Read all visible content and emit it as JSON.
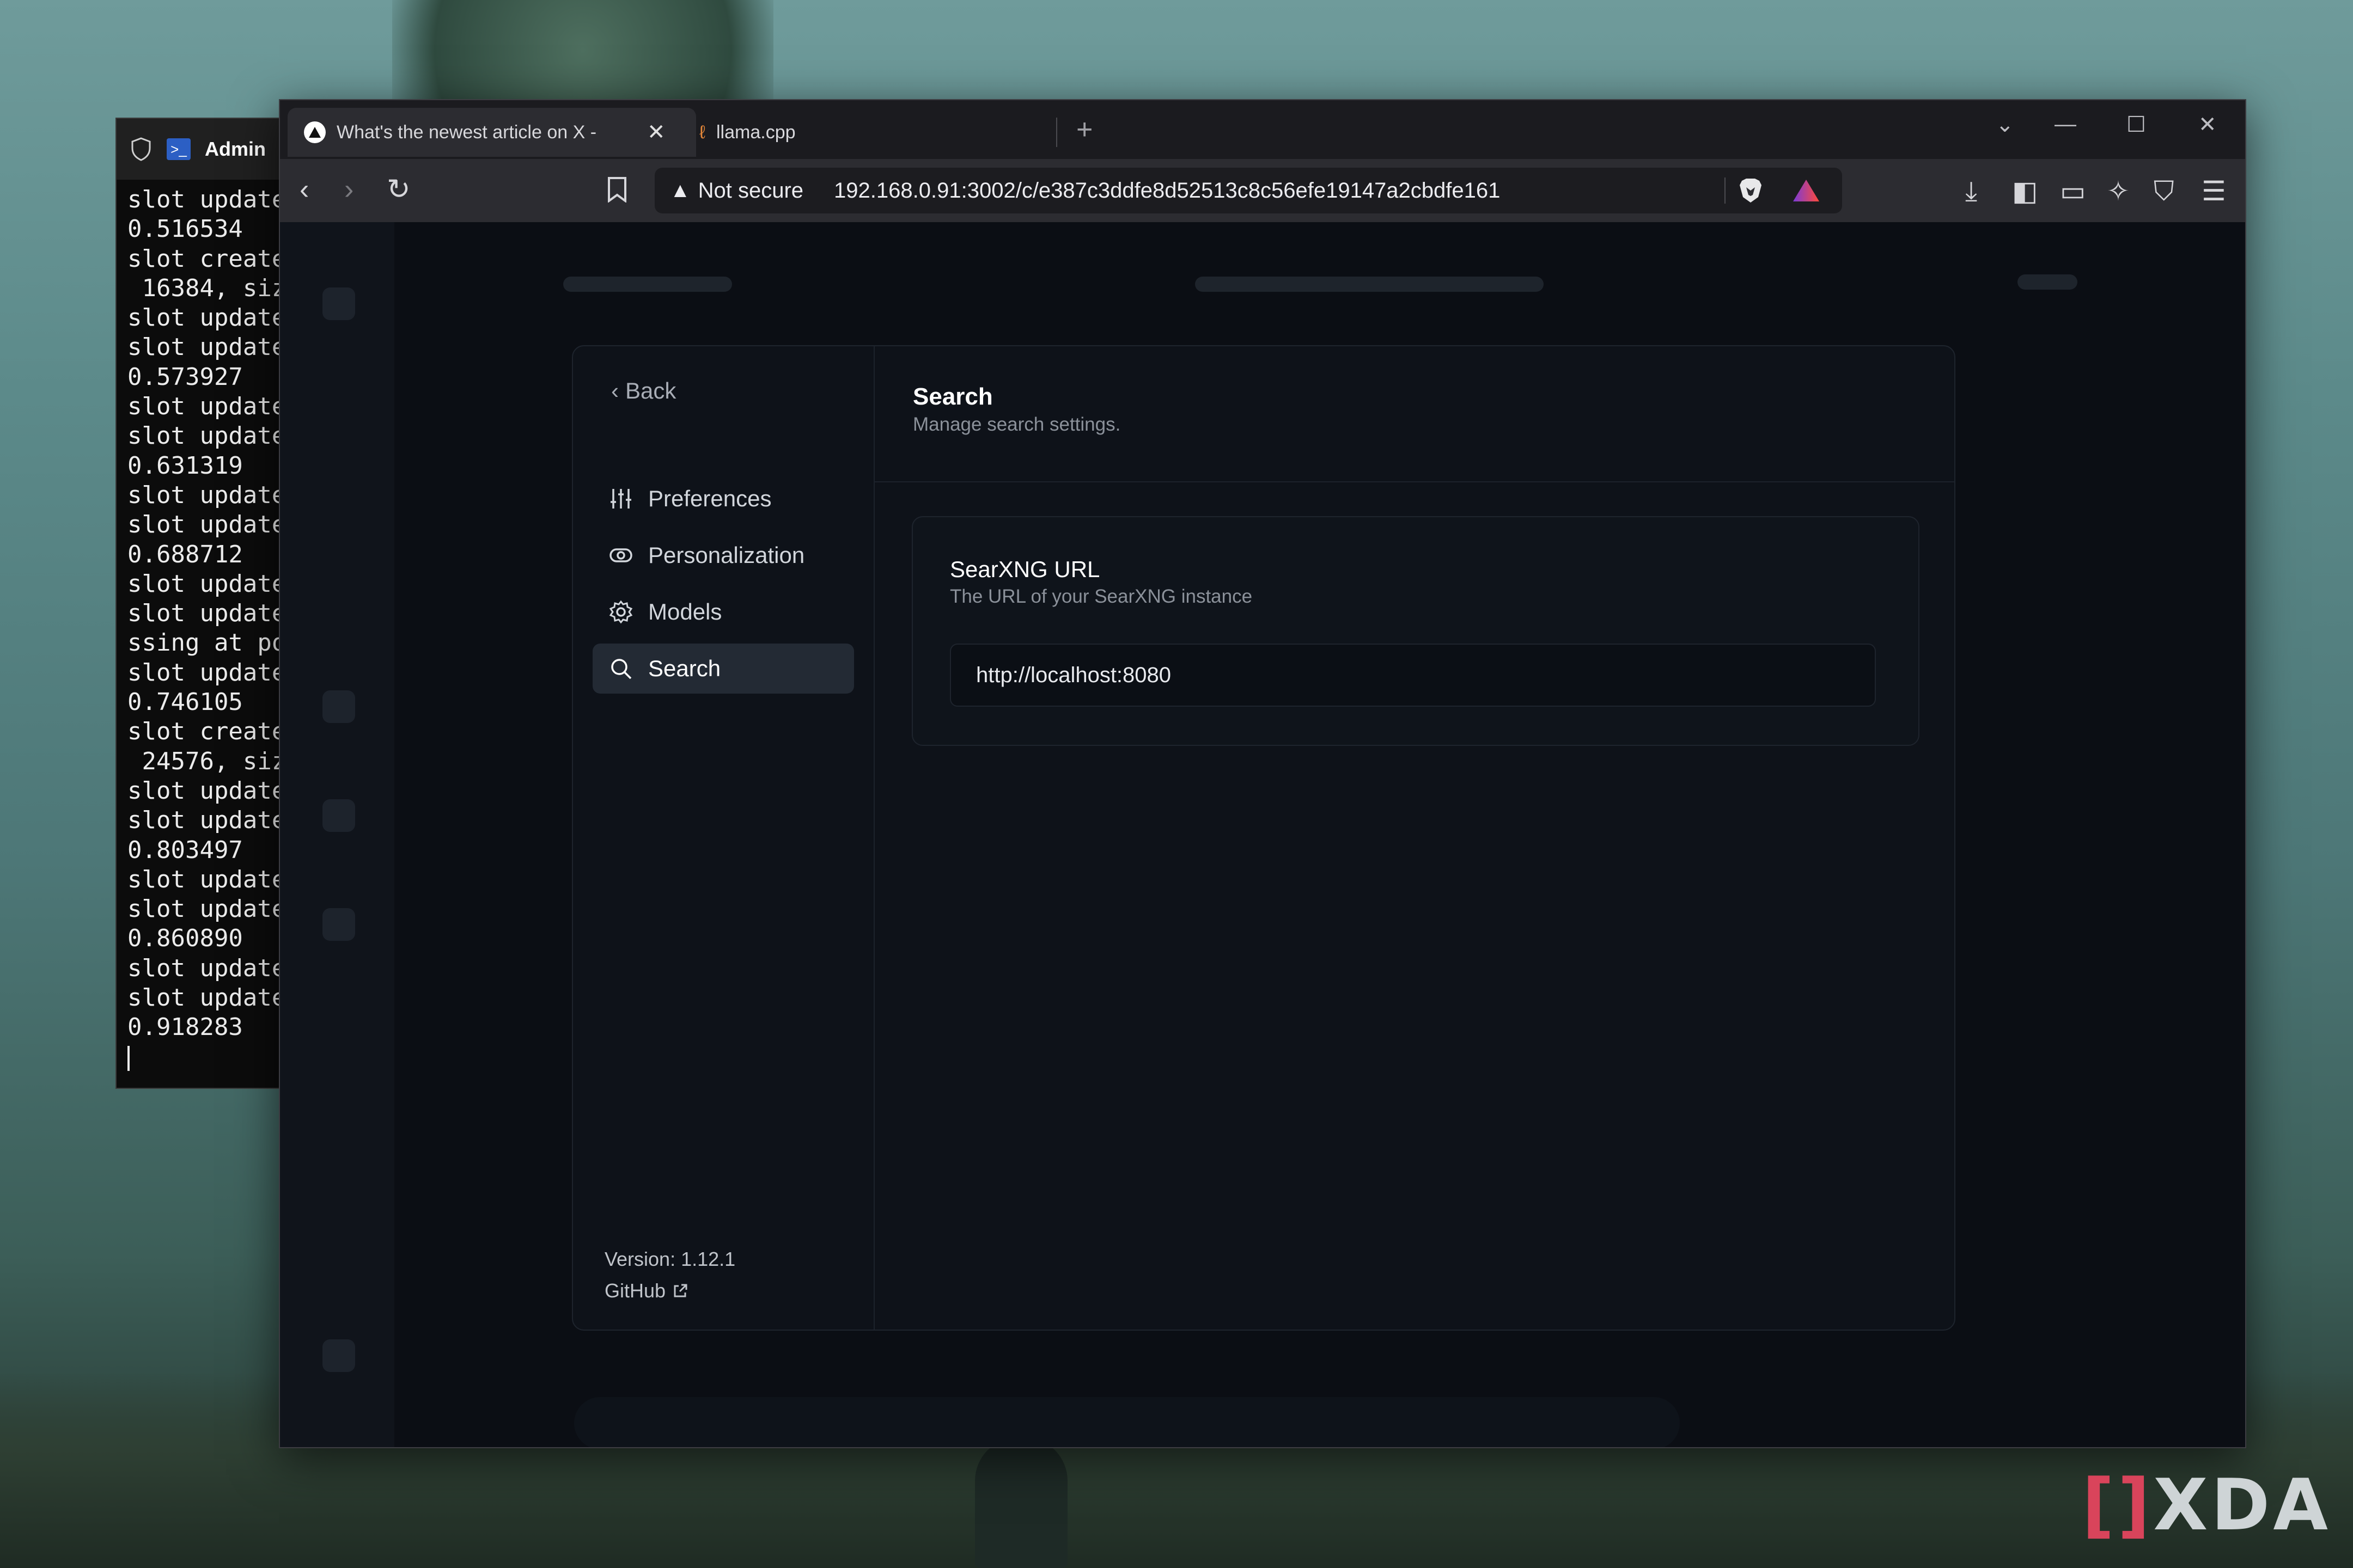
{
  "terminal": {
    "tab_label": "Admin",
    "lines": [
      "slot update",
      "0.516534",
      "slot create",
      " 16384, siz",
      "slot update",
      "slot update",
      "0.573927",
      "slot update",
      "slot update",
      "0.631319",
      "slot update",
      "slot update",
      "0.688712",
      "slot update",
      "slot update",
      "ssing at po",
      "slot update",
      "0.746105",
      "slot create",
      " 24576, siz",
      "slot update",
      "slot update",
      "0.803497",
      "slot update",
      "slot update",
      "0.860890",
      "slot update",
      "slot update",
      "0.918283"
    ]
  },
  "browser": {
    "tabs": [
      {
        "title": "What's the newest article on X - ",
        "active": true
      },
      {
        "title": "llama.cpp",
        "active": false
      }
    ],
    "address": {
      "security_label": "Not secure",
      "url": "192.168.0.91:3002/c/e387c3ddfe8d52513c8c56efe19147a2cbdfe161"
    }
  },
  "settings": {
    "back_label": "Back",
    "nav": [
      {
        "label": "Preferences",
        "icon": "sliders-icon",
        "active": false
      },
      {
        "label": "Personalization",
        "icon": "toggle-icon",
        "active": false
      },
      {
        "label": "Models",
        "icon": "gear-icon",
        "active": false
      },
      {
        "label": "Search",
        "icon": "search-icon",
        "active": true
      }
    ],
    "version": "Version: 1.12.1",
    "github_label": "GitHub",
    "header": {
      "title": "Search",
      "subtitle": "Manage search settings."
    },
    "searxng": {
      "title": "SearXNG URL",
      "subtitle": "The URL of your SearXNG instance",
      "value": "http://localhost:8080"
    }
  },
  "watermark": "XDA",
  "colors": {
    "page_bg": "#0b0e14",
    "modal_bg": "#0e1219",
    "active_nav": "#232a34",
    "toolbar": "#2c2c31"
  }
}
